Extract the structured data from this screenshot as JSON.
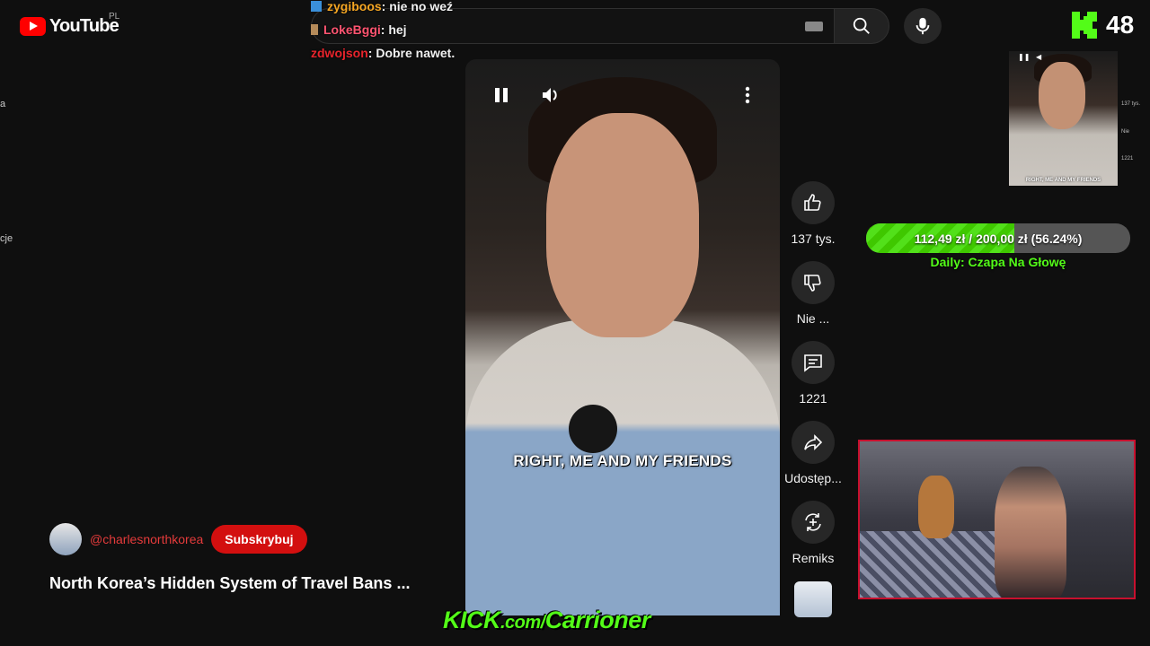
{
  "header": {
    "logo_text": "YouTube",
    "region": "PL"
  },
  "chat": [
    {
      "user": "zygiboos",
      "message": ": nie no weź"
    },
    {
      "user": "LokeBggi",
      "message": ": hej"
    },
    {
      "user": "zdwojson",
      "message": ": Dobre nawet."
    }
  ],
  "kick": {
    "viewer_count": "48"
  },
  "sidebar_fragments": [
    "a",
    "cje"
  ],
  "video": {
    "caption": "RIGHT, ME AND MY FRIENDS",
    "channel_handle": "@charlesnorthkorea",
    "subscribe_label": "Subskrybuj",
    "title": "North Korea’s Hidden System of Travel Bans ..."
  },
  "actions": {
    "like_count": "137 tys.",
    "dislike_label": "Nie ...",
    "comments_count": "1221",
    "share_label": "Udostęp...",
    "remix_label": "Remiks"
  },
  "mini_preview": {
    "caption": "RIGHT, ME AND MY FRIENDS",
    "side_labels": [
      "137 tys.",
      "Nie",
      "1221"
    ]
  },
  "goal": {
    "text": "112,49 zł / 200,00 zł (56.24%)",
    "progress": 0.5624,
    "subtitle": "Daily: Czapa Na Głowę"
  },
  "banner": {
    "kick": "KICK",
    "domain": ".com/",
    "channel": "Carrioner"
  },
  "colors": {
    "kick_green": "#53fc18",
    "yt_red": "#ff0000",
    "cam_border": "#c8102e"
  }
}
